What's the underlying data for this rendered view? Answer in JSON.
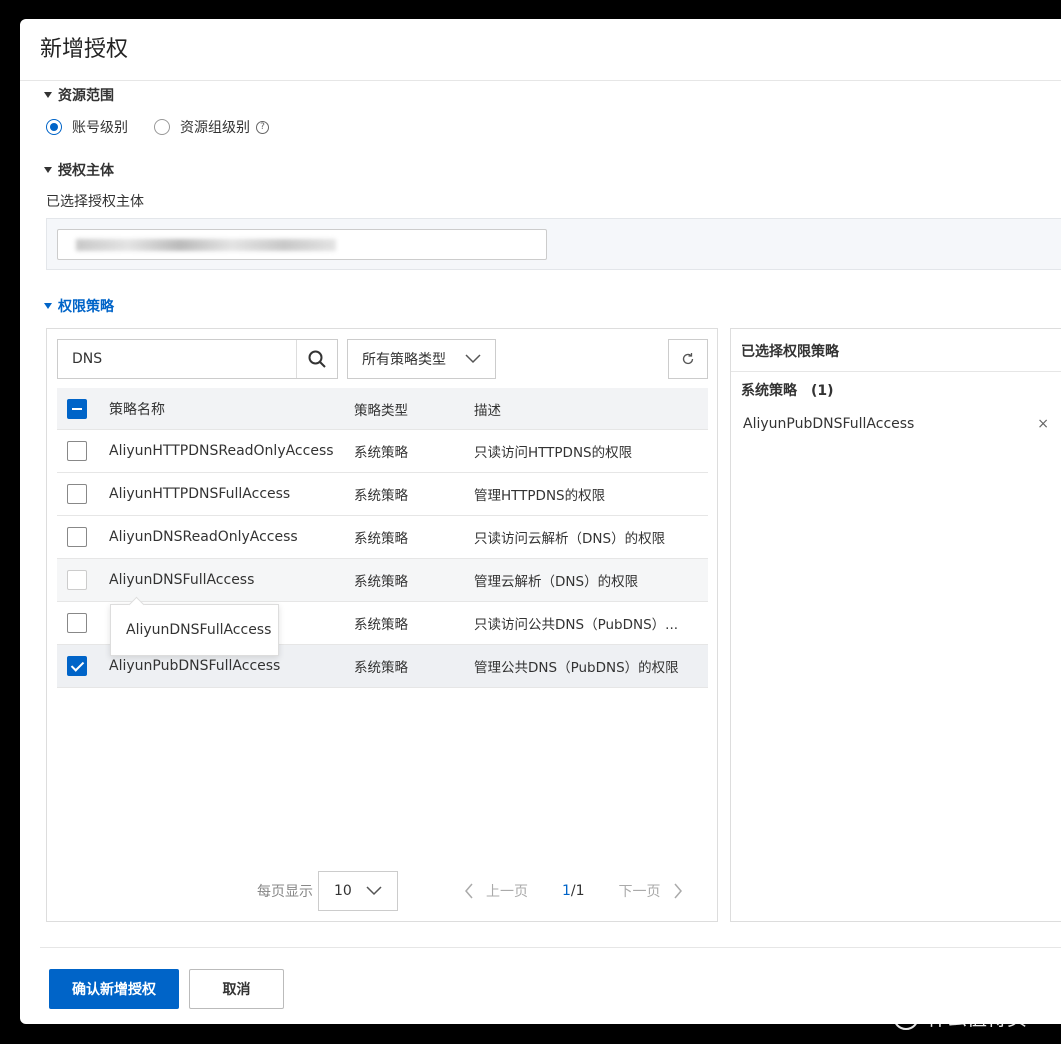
{
  "dialog": {
    "title": "新增授权"
  },
  "resource_scope": {
    "heading": "资源范围",
    "options": [
      {
        "label": "账号级别",
        "checked": true
      },
      {
        "label": "资源组级别",
        "checked": false
      }
    ],
    "help_icon": "question-circle-icon"
  },
  "principal": {
    "heading": "授权主体",
    "selected_label": "已选择授权主体"
  },
  "policies": {
    "heading": "权限策略",
    "search_value": "DNS",
    "type_filter": "所有策略类型",
    "columns": {
      "name": "策略名称",
      "type": "策略类型",
      "desc": "描述"
    },
    "rows": [
      {
        "name": "AliyunHTTPDNSReadOnlyAccess",
        "type": "系统策略",
        "desc": "只读访问HTTPDNS的权限",
        "checked": false
      },
      {
        "name": "AliyunHTTPDNSFullAccess",
        "type": "系统策略",
        "desc": "管理HTTPDNS的权限",
        "checked": false
      },
      {
        "name": "AliyunDNSReadOnlyAccess",
        "type": "系统策略",
        "desc": "只读访问云解析（DNS）的权限",
        "checked": false
      },
      {
        "name": "AliyunDNSFullAccess",
        "type": "系统策略",
        "desc": "管理云解析（DNS）的权限",
        "checked": false
      },
      {
        "name": "ccess",
        "type": "系统策略",
        "desc": "只读访问公共DNS（PubDNS）...",
        "checked": false
      },
      {
        "name": "AliyunPubDNSFullAccess",
        "type": "系统策略",
        "desc": "管理公共DNS（PubDNS）的权限",
        "checked": true
      }
    ],
    "tooltip": "AliyunDNSFullAccess",
    "pager": {
      "per_page_label": "每页显示",
      "page_size": "10",
      "prev": "上一页",
      "next": "下一页",
      "current": "1",
      "total": "/1"
    }
  },
  "selected_policies": {
    "title": "已选择权限策略",
    "group_label": "系统策略　(1)",
    "items": [
      {
        "name": "AliyunPubDNSFullAccess"
      }
    ],
    "remove_symbol": "×"
  },
  "footer": {
    "confirm": "确认新增授权",
    "cancel": "取消"
  },
  "watermark": {
    "logo": "值",
    "text": "什么值得买"
  },
  "colors": {
    "primary": "#0064c8",
    "border": "#dddddd"
  }
}
